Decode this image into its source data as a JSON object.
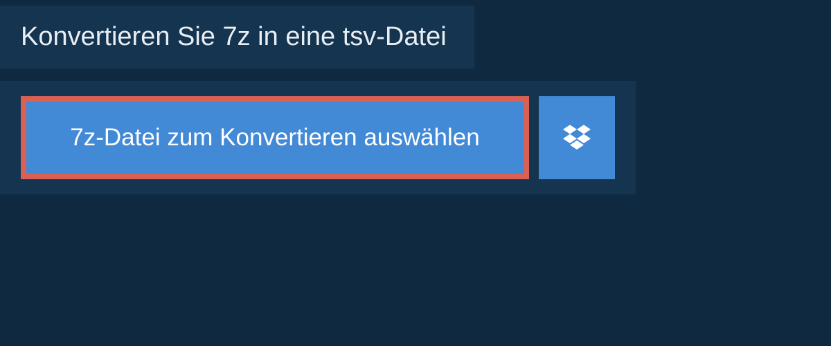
{
  "header": {
    "title": "Konvertieren Sie 7z in eine tsv-Datei"
  },
  "upload": {
    "select_file_label": "7z-Datei zum Konvertieren auswählen"
  }
}
